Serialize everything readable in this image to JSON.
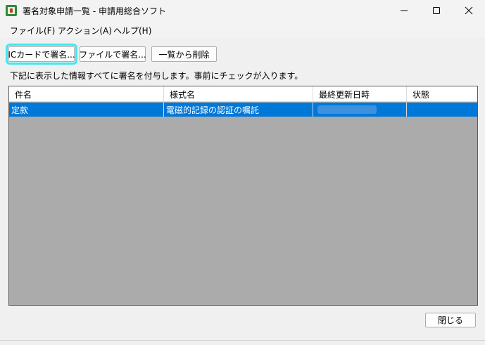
{
  "window": {
    "title": "署名対象申請一覧 - 申請用総合ソフト"
  },
  "menu": [
    {
      "label": "ファイル(F)"
    },
    {
      "label": "アクション(A)"
    },
    {
      "label": "ヘルプ(H)"
    }
  ],
  "toolbar": {
    "ic_sign": "ICカードで署名...",
    "file_sign": "ファイルで署名...",
    "remove": "一覧から削除"
  },
  "info_text": "下記に表示した情報すべてに署名を付与します。事前にチェックが入ります。",
  "table": {
    "columns": [
      "件名",
      "様式名",
      "最終更新日時",
      "状態"
    ],
    "rows": [
      {
        "subject": "定款",
        "form": "電磁的記録の認証の嘱託",
        "updated": "",
        "status": ""
      }
    ]
  },
  "footer": {
    "close": "閉じる"
  },
  "colors": {
    "selection": "#0078d7",
    "focus_ring": "#3ee8f0",
    "table_empty": "#ababab"
  }
}
